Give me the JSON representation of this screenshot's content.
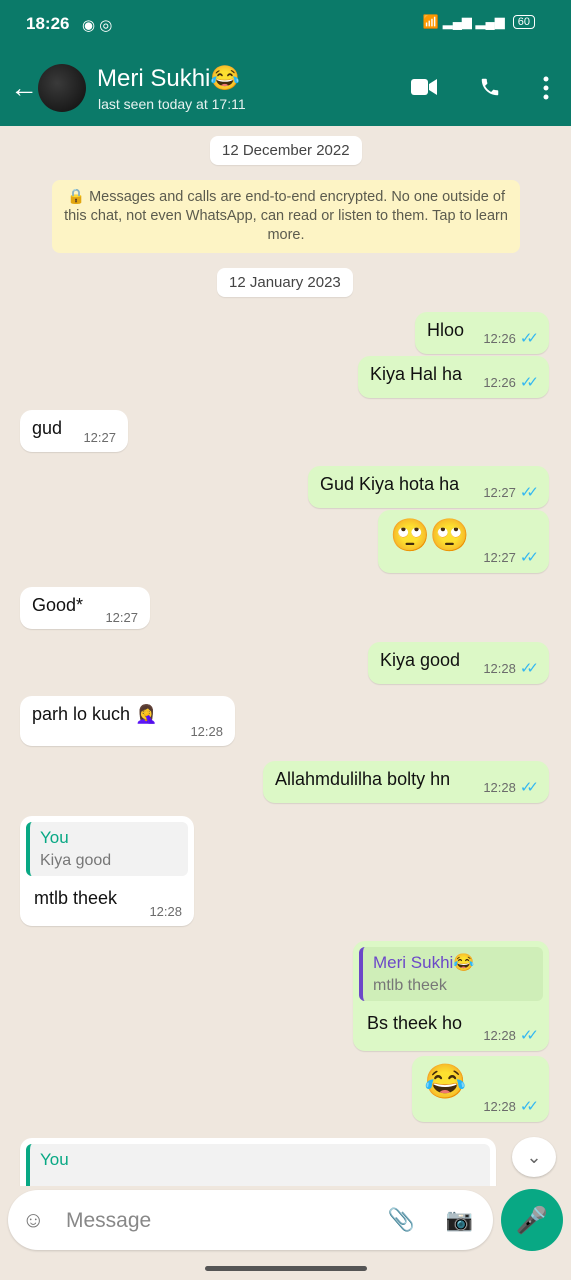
{
  "status_bar": {
    "time": "18:26",
    "left_icons": "◉ ◎",
    "battery": "60",
    "signal": "📶 ▂▄▆ ▂▄▆"
  },
  "header": {
    "contact_name": "Meri Sukhi😂",
    "last_seen": "last seen today at 17:11"
  },
  "dates": {
    "first": "12 December 2022",
    "second": "12 January 2023"
  },
  "encryption_notice": "🔒 Messages and calls are end-to-end encrypted. No one outside of this chat, not even WhatsApp, can read or listen to them. Tap to learn more.",
  "messages": [
    {
      "text": "Hloo",
      "time": "12:26"
    },
    {
      "text": "Kiya Hal ha",
      "time": "12:26"
    },
    {
      "text": "gud",
      "time": "12:27"
    },
    {
      "text": "Gud Kiya hota ha",
      "time": "12:27"
    },
    {
      "text": "🙄🙄",
      "time": "12:27"
    },
    {
      "text": "Good*",
      "time": "12:27"
    },
    {
      "text": "Kiya good",
      "time": "12:28"
    },
    {
      "text": "parh lo kuch 🤦‍♀️",
      "time": "12:28"
    },
    {
      "text": "Allahmdulilha bolty hn",
      "time": "12:28"
    },
    {
      "text": "mtlb theek",
      "time": "12:28",
      "quote_author": "You",
      "quote_text": "Kiya good"
    },
    {
      "text": "Bs theek ho",
      "time": "12:28",
      "quote_author": "Meri Sukhi😂",
      "quote_text": "mtlb theek"
    },
    {
      "text": "😂",
      "time": "12:28"
    },
    {
      "quote_author": "You"
    }
  ],
  "composer": {
    "placeholder": "Message"
  },
  "icons": {
    "back": "arrow-left-icon",
    "video": "video-call-icon",
    "call": "phone-icon",
    "menu": "more-vert-icon",
    "emoji": "emoji-icon",
    "attach": "paperclip-icon",
    "camera": "camera-icon",
    "mic": "mic-icon",
    "scroll": "chevron-down-icon"
  },
  "colors": {
    "header": "#0b7a69",
    "outgoing": "#dcf8c6",
    "incoming": "#ffffff",
    "accent": "#08a884"
  }
}
